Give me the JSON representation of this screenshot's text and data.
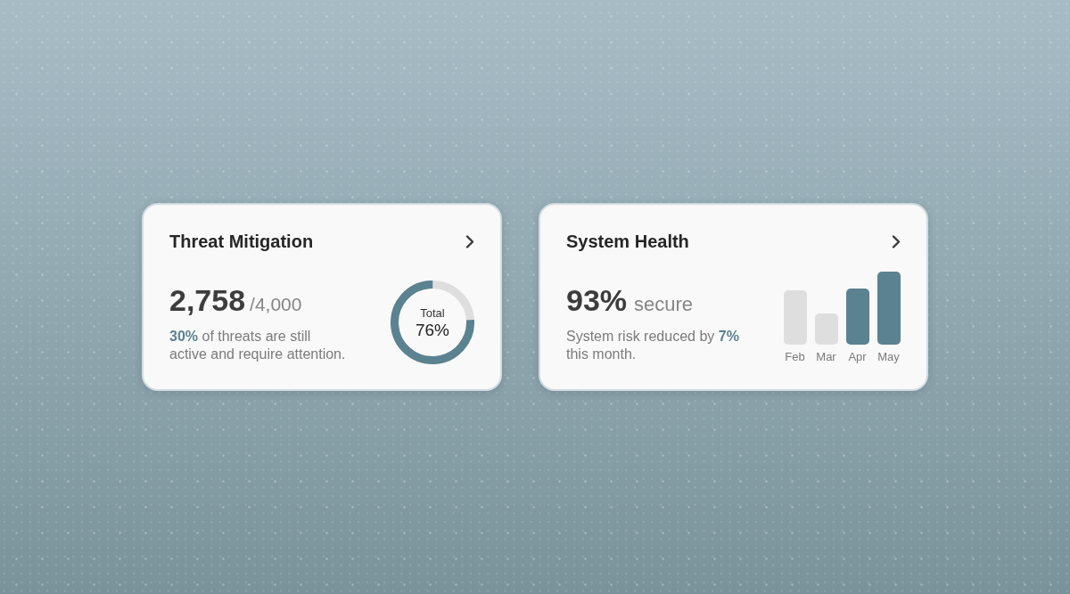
{
  "cards": [
    {
      "kind": "ring",
      "title": "Threat Mitigation",
      "value": "2,758",
      "suffix": "/4,000",
      "description": "**30%** of threats are still active and require attention.",
      "ring": {
        "label": "Total",
        "reading": "76%",
        "level": 0.76
      }
    },
    {
      "kind": "bars",
      "title": "System Health",
      "value": "93%",
      "suffix": "secure",
      "description": "System risk reduced by **7%** this month.",
      "bars": [
        {
          "label": "Feb",
          "highlighted": false
        },
        {
          "label": "Mar",
          "highlighted": false
        },
        {
          "label": "Apr",
          "highlighted": true
        },
        {
          "label": "May",
          "highlighted": true
        }
      ]
    }
  ]
}
